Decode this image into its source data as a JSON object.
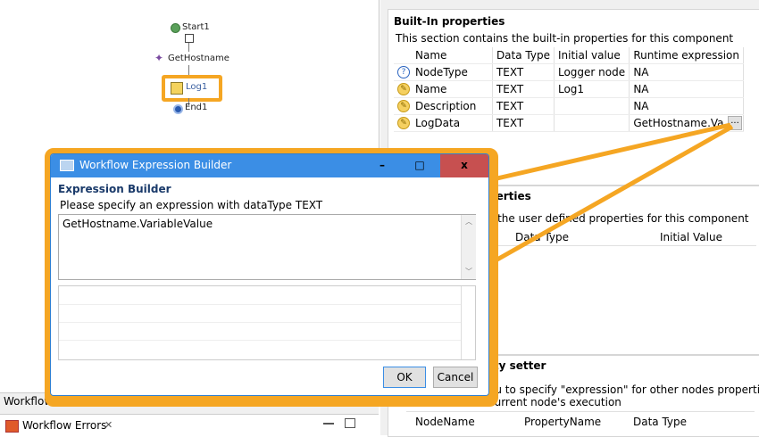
{
  "workflow": {
    "nodes": [
      {
        "label": "Start1",
        "icon": "green-circle-icon"
      },
      {
        "label": "GetHostname",
        "icon": "star-icon"
      },
      {
        "label": "Log1",
        "icon": "log-icon"
      },
      {
        "label": "End1",
        "icon": "blue-circle-icon"
      }
    ]
  },
  "bottom_tabs": {
    "workflow_tab": "Workflow",
    "errors_tab": "Workflow Errors",
    "errors_close": "✕"
  },
  "builtin": {
    "title": "Built-In properties",
    "description": "This section contains the built-in properties for this component",
    "columns": [
      "Name",
      "Data Type",
      "Initial value",
      "Runtime expression"
    ],
    "rows": [
      {
        "icon": "question-icon",
        "name": "NodeType",
        "type": "TEXT",
        "initial": "Logger node",
        "runtime": "NA"
      },
      {
        "icon": "pencil-icon",
        "name": "Name",
        "type": "TEXT",
        "initial": "Log1",
        "runtime": "NA"
      },
      {
        "icon": "pencil-icon",
        "name": "Description",
        "type": "TEXT",
        "initial": "",
        "runtime": "NA"
      },
      {
        "icon": "pencil-icon",
        "name": "LogData",
        "type": "TEXT",
        "initial": "",
        "runtime": "GetHostname.Va"
      }
    ],
    "browse_button": "..."
  },
  "userdefined": {
    "title_partial": "perties",
    "description_partial": "s the user defined properties for this component",
    "columns": [
      "Data Type",
      "Initial Value"
    ]
  },
  "setter": {
    "title_partial": "rty setter",
    "description_partial": "ou to specify \"expression\" for other nodes properties. Pro",
    "description_partial2": "current node's execution",
    "columns": [
      "NodeName",
      "PropertyName",
      "Data Type"
    ]
  },
  "dialog": {
    "title": "Workflow Expression Builder",
    "heading": "Expression Builder",
    "prompt": "Please specify an expression with dataType TEXT",
    "expression": "GetHostname.VariableValue",
    "ok": "OK",
    "cancel": "Cancel",
    "minimize": "–",
    "maximize": "□",
    "close": "x"
  },
  "colors": {
    "callout": "#f5a623",
    "titlebar": "#3b8ee5",
    "close": "#c75050"
  }
}
